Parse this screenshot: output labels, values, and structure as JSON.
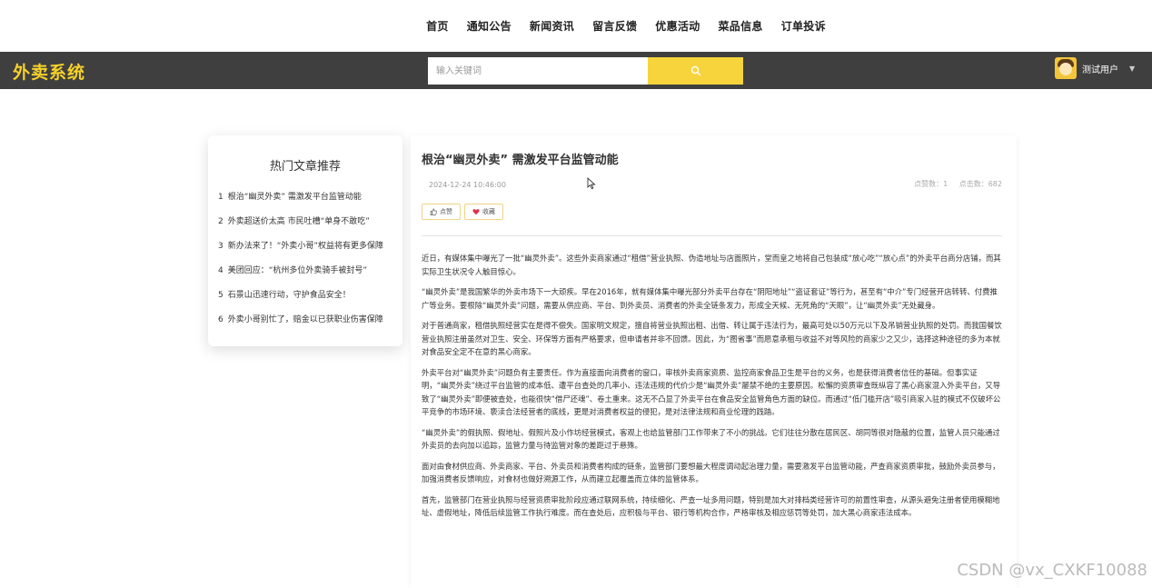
{
  "nav": {
    "items": [
      "首页",
      "通知公告",
      "新闻资讯",
      "留言反馈",
      "优惠活动",
      "菜品信息",
      "订单投诉"
    ]
  },
  "header": {
    "brand": "外卖系统",
    "search_placeholder": "输入关键词",
    "search_icon": "search-icon",
    "user_name": "测试用户",
    "brand_color": "#f6d12a",
    "bar_color": "#3f3f3f",
    "accent_color": "#f8d43c"
  },
  "sidebar": {
    "title": "热门文章推荐",
    "items": [
      {
        "num": "1",
        "label": "根治“幽灵外卖” 需激发平台监管动能"
      },
      {
        "num": "2",
        "label": "外卖超送价太高 市民吐槽“单身不敢吃”"
      },
      {
        "num": "3",
        "label": "新办法来了！“外卖小哥”权益将有更多保障"
      },
      {
        "num": "4",
        "label": "美团回应：“杭州多位外卖骑手被封号”"
      },
      {
        "num": "5",
        "label": "石景山迅速行动，守护食品安全！"
      },
      {
        "num": "6",
        "label": "外卖小哥别忙了，赔金以已获职业伤害保障"
      }
    ]
  },
  "article": {
    "title": "根治“幽灵外卖” 需激发平台监管动能",
    "date": "2024-12-24 10:46:00",
    "likes_label": "点赞数：1",
    "clicks_label": "点击数：682",
    "like_button": "点赞",
    "collect_button": "收藏",
    "paragraphs": [
      "近日，有媒体集中曝光了一批“幽灵外卖”。这些外卖商家通过“租借”营业执照、伪造地址与店面照片，堂而皇之地将自己包装成“放心吃”“放心点”的外卖平台商分店铺，而其实际卫生状况令人触目惊心。",
      "“幽灵外卖”是我国繁华的外卖市场下一大顽疾。早在2016年，就有媒体集中曝光部分外卖平台存在“阴阳地址”“盗证套证”等行为，甚至有“中介”专门经营开店转转、付费推广等业务。要根除“幽灵外卖”问题，需要从供应商、平台、到外卖员、消费者的外卖全链条发力，形成全天候、无死角的“天眼”，让“幽灵外卖”无处藏身。",
      "对于普通商家，租借执照经营实在是得不偿失。国家明文规定，擅自将营业执照出租、出借、转让属于违法行为，最高可处以50万元以下及吊销营业执照的处罚。而我国餐饮营业执照注册虽然对卫生、安全、环保等方面有严格要求，但申请者并非不回馈。因此，为“图省事”而愿意承租与收益不对等风险的商家少之又少，选择这种途径的多为本就对食品安全定不在意的黑心商家。",
      "外卖平台对“幽灵外卖”问题负有主要责任。作为直接面向消费者的窗口，审核外卖商家资质、监控商家食品卫生是平台的义务，也是获得消费者信任的基础。但事实证明，“幽灵外卖”绕过平台监管的成本低、遭平台查处的几率小、违法违规的代价少是“幽灵外卖”屡禁不绝的主要原因。松懈的资质审查既纵容了黑心商家混入外卖平台，又导致了“幽灵外卖”即便被查处，也能很快“借尸还魂”、卷土重来。这无不凸显了外卖平台在食品安全监管角色方面的缺位。而通过“低门槛开店”吸引商家入驻的模式不仅破坏公平竞争的市场环境、亵渎合法经营者的底线，更是对消费者权益的侵犯，是对法律法规和商业伦理的践踏。",
      "“幽灵外卖”的假执照、假地址、假照片及小作坊经营模式，客观上也给监管部门工作带来了不小的挑战。它们往往分散在居民区、胡同等很对隐蔽的位置，监管人员只能通过外卖员的去向加以追踪，监管力量与待监管对象的差距过于悬殊。",
      "面对由食材供应商、外卖商家、平台、外卖员和消费者构成的链条，监管部门要想最大程度调动起治理力量，需要激发平台监管动能，严查商家资质审批，鼓励外卖员参与，加强消费者反馈响应，对食材也做好溯源工作，从而建立起覆盖而立体的监管体系。",
      "首先，监管部门在营业执照与经营资质审批阶段应通过联网系统，持续细化、严查一址多用问题，特别是加大对排档类经营许可的前置性审查，从源头避免注册者使用模糊地址、虚假地址，降低后续监管工作执行难度。而在查处后，应积极与平台、银行等机构合作，严格审核及相应惩罚等处罚，加大黑心商家违法成本。"
    ]
  },
  "watermark": "CSDN @vx_CXKF10088"
}
